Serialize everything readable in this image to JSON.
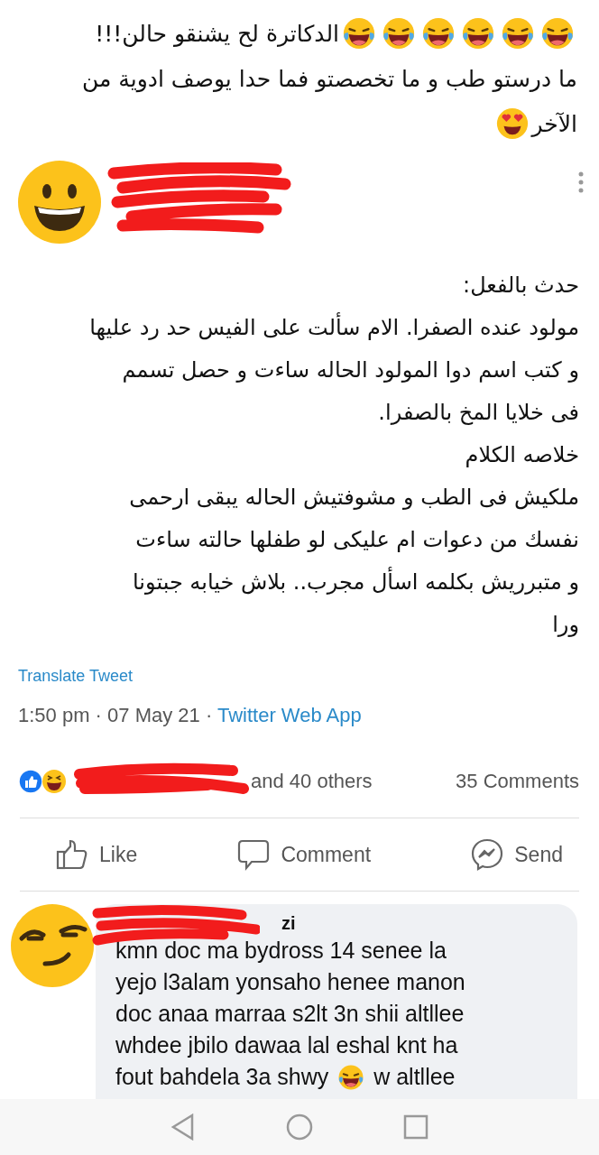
{
  "caption": {
    "lines": [
      {
        "segments": [
          {
            "kind": "laugh"
          },
          {
            "kind": "laugh"
          },
          {
            "kind": "laugh"
          },
          {
            "kind": "laugh"
          },
          {
            "kind": "laugh"
          },
          {
            "kind": "laugh"
          },
          {
            "kind": "text",
            "text": "الدكاترة لح يشنقو حالن!!!"
          }
        ]
      },
      {
        "segments": [
          {
            "kind": "text",
            "text": "ما درستو طب و ما تخصصتو فما حدا يوصف ادوية من"
          }
        ]
      },
      {
        "segments": [
          {
            "kind": "text",
            "text": "الآخر"
          },
          {
            "kind": "heart_eyes"
          }
        ]
      }
    ]
  },
  "tweet": {
    "lines": [
      "حدث بالفعل:",
      "مولود عنده الصفرا. الام سألت على الفيس حد رد عليها",
      "و كتب اسم دوا المولود الحاله ساءت و حصل تسمم",
      "فى خلايا المخ بالصفرا.",
      "خلاصه الكلام",
      "ملكيش فى الطب و مشوفتيش الحاله يبقى ارحمى",
      "نفسك من دعوات ام عليكى لو طفلها حالته ساءت",
      "و متبرريش بكلمه اسأل مجرب.. بلاش خيابه جبتونا",
      "ورا"
    ],
    "translate": "Translate Tweet",
    "time": "1:50 pm · 07 May 21 · ",
    "source": "Twitter Web App"
  },
  "reactions": {
    "summary": "and 40 others",
    "comments": "35 Comments"
  },
  "actions": {
    "like": {
      "label": "Like"
    },
    "comment": {
      "label": "Comment"
    },
    "send": {
      "label": "Send"
    }
  },
  "comment": {
    "author_fragment": "zi",
    "lines": [
      {
        "segments": [
          {
            "kind": "text",
            "text": "kmn doc ma bydross 14 senee la"
          }
        ]
      },
      {
        "segments": [
          {
            "kind": "text",
            "text": "yejo l3alam yonsaho henee manon"
          }
        ]
      },
      {
        "segments": [
          {
            "kind": "text",
            "text": "doc anaa marraa s2lt 3n shii altllee"
          }
        ]
      },
      {
        "segments": [
          {
            "kind": "text",
            "text": "whdee jbilo dawaa lal eshal knt ha"
          }
        ]
      },
      {
        "before": "fout bahdela 3a shwy ",
        "emoji": {
          "kind": "laugh"
        },
        "after": " w altllee"
      }
    ]
  }
}
